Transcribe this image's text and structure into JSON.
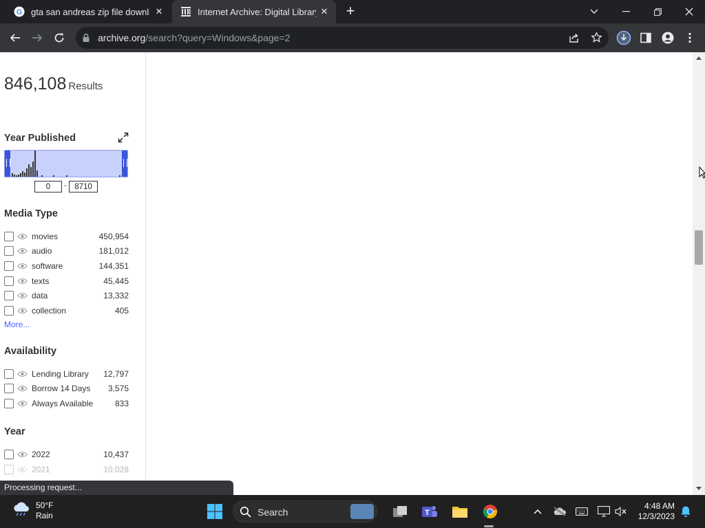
{
  "browser": {
    "tabs": [
      {
        "title": "gta san andreas zip file download",
        "active": false
      },
      {
        "title": "Internet Archive: Digital Library of Free & Borrowable Books",
        "active": true
      }
    ],
    "url_host": "archive.org",
    "url_path": "/search?query=Windows&page=2"
  },
  "sidebar": {
    "results_count": "846,108",
    "results_label": "Results",
    "year_published": {
      "heading": "Year Published",
      "from": "0",
      "to": "8710",
      "dash": "-"
    },
    "media_type": {
      "heading": "Media Type",
      "items": [
        {
          "label": "movies",
          "count": "450,954"
        },
        {
          "label": "audio",
          "count": "181,012"
        },
        {
          "label": "software",
          "count": "144,351"
        },
        {
          "label": "texts",
          "count": "45,445"
        },
        {
          "label": "data",
          "count": "13,332"
        },
        {
          "label": "collection",
          "count": "405"
        }
      ],
      "more": "More..."
    },
    "availability": {
      "heading": "Availability",
      "items": [
        {
          "label": "Lending Library",
          "count": "12,797"
        },
        {
          "label": "Borrow 14 Days",
          "count": "3,575"
        },
        {
          "label": "Always Available",
          "count": "833"
        }
      ]
    },
    "year": {
      "heading": "Year",
      "items": [
        {
          "label": "2022",
          "count": "10,437"
        },
        {
          "label": "2021",
          "count": "10,028"
        }
      ]
    }
  },
  "status": {
    "text": "Processing request..."
  },
  "taskbar": {
    "weather_temp": "50°F",
    "weather_desc": "Rain",
    "search_label": "Search",
    "time": "4:48 AM",
    "date": "12/3/2023"
  }
}
